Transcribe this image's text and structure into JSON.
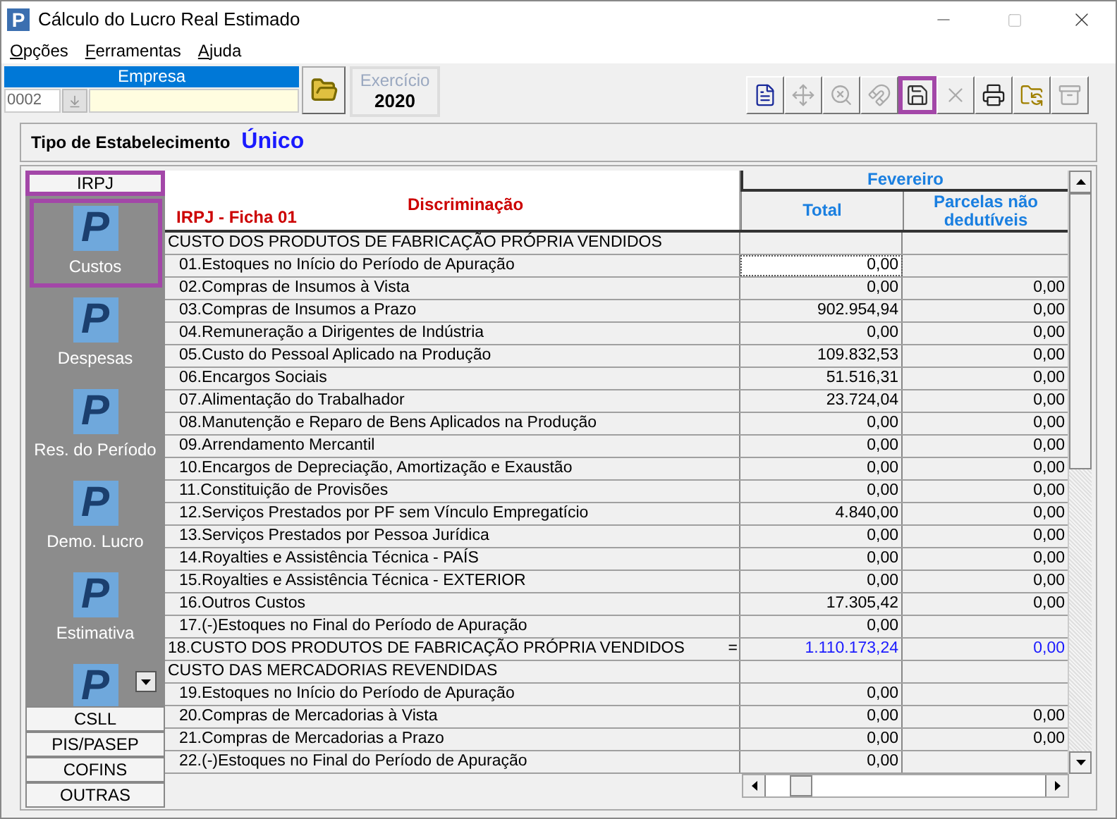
{
  "window": {
    "title": "Cálculo do Lucro Real Estimado",
    "app_icon": "P"
  },
  "menu": [
    {
      "mnemonic": "O",
      "rest": "pções"
    },
    {
      "mnemonic": "F",
      "rest": "erramentas"
    },
    {
      "mnemonic": "A",
      "rest": "juda"
    }
  ],
  "empresa": {
    "label": "Empresa",
    "code": "0002"
  },
  "exercicio": {
    "label": "Exercício",
    "value": "2020"
  },
  "toolbar": [
    {
      "kind": "document",
      "disabled": false,
      "highlighted": false
    },
    {
      "kind": "move",
      "disabled": true,
      "highlighted": false
    },
    {
      "kind": "search",
      "disabled": true,
      "highlighted": false
    },
    {
      "kind": "magnet",
      "disabled": true,
      "highlighted": false
    },
    {
      "kind": "save",
      "disabled": false,
      "highlighted": true
    },
    {
      "kind": "close",
      "disabled": true,
      "highlighted": false
    },
    {
      "kind": "printer",
      "disabled": false,
      "highlighted": false
    },
    {
      "kind": "folders",
      "disabled": false,
      "highlighted": false
    },
    {
      "kind": "drawer",
      "disabled": true,
      "highlighted": false
    }
  ],
  "tipo": {
    "label": "Tipo de Estabelecimento",
    "value": "Único"
  },
  "sidebar": {
    "top_tab": {
      "label": "IRPJ",
      "selected": true
    },
    "items": [
      {
        "icon_letter": "P",
        "label": "Custos",
        "selected": true
      },
      {
        "icon_letter": "P",
        "label": "Despesas",
        "selected": false
      },
      {
        "icon_letter": "P",
        "label": "Res. do Período",
        "selected": false
      },
      {
        "icon_letter": "P",
        "label": "Demo. Lucro",
        "selected": false
      },
      {
        "icon_letter": "P",
        "label": "Estimativa",
        "selected": false
      },
      {
        "icon_letter": "P",
        "selected": false
      }
    ],
    "bottom_tabs": [
      {
        "label": "CSLL",
        "selected": false
      },
      {
        "label": "PIS/PASEP",
        "selected": false
      },
      {
        "label": "COFINS",
        "selected": false
      },
      {
        "label": "OUTRAS",
        "selected": false
      }
    ]
  },
  "table": {
    "ficha": "IRPJ - Ficha 01",
    "label_heading": "Discriminação",
    "month": "Fevereiro",
    "columns": [
      "Total",
      "Parcelas não dedutíveis"
    ],
    "rows": [
      {
        "kind": "section",
        "label": "CUSTO DOS PRODUTOS DE FABRICAÇÃO PRÓPRIA VENDIDOS",
        "focused": false
      },
      {
        "kind": "item",
        "label": "01.Estoques no Início do Período de Apuração",
        "total": "0,00",
        "focused": true
      },
      {
        "kind": "item",
        "label": "02.Compras de Insumos à Vista",
        "total": "0,00",
        "parcelas": "0,00",
        "focused": false
      },
      {
        "kind": "item",
        "label": "03.Compras de Insumos a Prazo",
        "total": "902.954,94",
        "parcelas": "0,00",
        "focused": false
      },
      {
        "kind": "item",
        "label": "04.Remuneração a Dirigentes de Indústria",
        "total": "0,00",
        "parcelas": "0,00",
        "focused": false
      },
      {
        "kind": "item",
        "label": "05.Custo do Pessoal Aplicado na Produção",
        "total": "109.832,53",
        "parcelas": "0,00",
        "focused": false
      },
      {
        "kind": "item",
        "label": "06.Encargos Sociais",
        "total": "51.516,31",
        "parcelas": "0,00",
        "focused": false
      },
      {
        "kind": "item",
        "label": "07.Alimentação do Trabalhador",
        "total": "23.724,04",
        "parcelas": "0,00",
        "focused": false
      },
      {
        "kind": "item",
        "label": "08.Manutenção e Reparo de Bens Aplicados na Produção",
        "total": "0,00",
        "parcelas": "0,00",
        "focused": false
      },
      {
        "kind": "item",
        "label": "09.Arrendamento Mercantil",
        "total": "0,00",
        "parcelas": "0,00",
        "focused": false
      },
      {
        "kind": "item",
        "label": "10.Encargos de Depreciação, Amortização e Exaustão",
        "total": "0,00",
        "parcelas": "0,00",
        "focused": false
      },
      {
        "kind": "item",
        "label": "11.Constituição de Provisões",
        "total": "0,00",
        "parcelas": "0,00",
        "focused": false
      },
      {
        "kind": "item",
        "label": "12.Serviços Prestados por PF sem Vínculo Empregatício",
        "total": "4.840,00",
        "parcelas": "0,00",
        "focused": false
      },
      {
        "kind": "item",
        "label": "13.Serviços Prestados por Pessoa Jurídica",
        "total": "0,00",
        "parcelas": "0,00",
        "focused": false
      },
      {
        "kind": "item",
        "label": "14.Royalties e Assistência Técnica - PAÍS",
        "total": "0,00",
        "parcelas": "0,00",
        "focused": false
      },
      {
        "kind": "item",
        "label": "15.Royalties e Assistência Técnica - EXTERIOR",
        "total": "0,00",
        "parcelas": "0,00",
        "focused": false
      },
      {
        "kind": "item",
        "label": "16.Outros Custos",
        "total": "17.305,42",
        "parcelas": "0,00",
        "focused": false
      },
      {
        "kind": "item",
        "label": "17.(-)Estoques no Final do Período de Apuração",
        "total": "0,00",
        "focused": false
      },
      {
        "kind": "total",
        "label": "18.CUSTO DOS PRODUTOS DE FABRICAÇÃO PRÓPRIA VENDIDOS",
        "marker": "=",
        "total": "1.110.173,24",
        "parcelas": "0,00",
        "focused": false
      },
      {
        "kind": "section",
        "label": "CUSTO DAS MERCADORIAS REVENDIDAS",
        "focused": false
      },
      {
        "kind": "item",
        "label": "19.Estoques no Início do Período de Apuração",
        "total": "0,00",
        "focused": false
      },
      {
        "kind": "item",
        "label": "20.Compras de Mercadorias à Vista",
        "total": "0,00",
        "parcelas": "0,00",
        "focused": false
      },
      {
        "kind": "item",
        "label": "21.Compras de Mercadorias a Prazo",
        "total": "0,00",
        "parcelas": "0,00",
        "focused": false
      },
      {
        "kind": "item",
        "label": "22.(-)Estoques no Final do Período de Apuração",
        "total": "0,00",
        "focused": false
      }
    ]
  }
}
